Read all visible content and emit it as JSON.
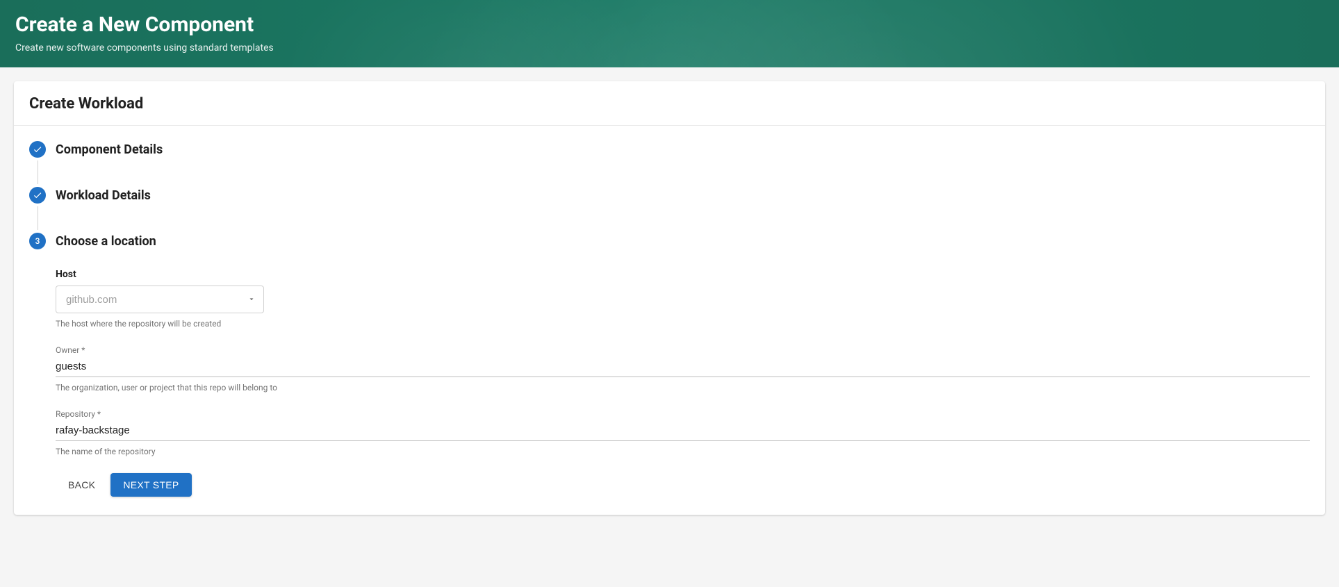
{
  "header": {
    "title": "Create a New Component",
    "subtitle": "Create new software components using standard templates"
  },
  "card": {
    "title": "Create Workload"
  },
  "steps": [
    {
      "label": "Component Details",
      "state": "done"
    },
    {
      "label": "Workload Details",
      "state": "done"
    },
    {
      "label": "Choose a location",
      "state": "active",
      "number": "3"
    }
  ],
  "form": {
    "host": {
      "label": "Host",
      "value": "github.com",
      "helper": "The host where the repository will be created"
    },
    "owner": {
      "label": "Owner *",
      "value": "guests",
      "helper": "The organization, user or project that this repo will belong to"
    },
    "repository": {
      "label": "Repository *",
      "value": "rafay-backstage",
      "helper": "The name of the repository"
    }
  },
  "actions": {
    "back": "BACK",
    "next": "NEXT STEP"
  }
}
